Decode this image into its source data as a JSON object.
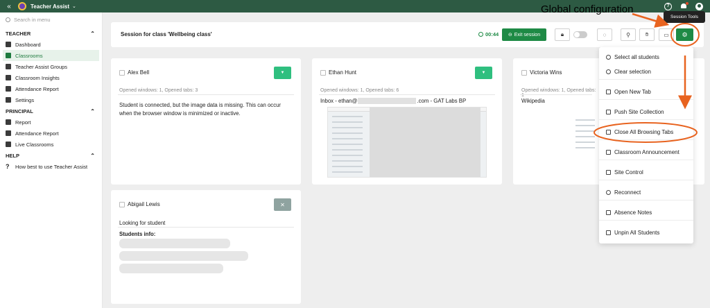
{
  "topbar": {
    "app_name": "Teacher Assist",
    "colors": {
      "bar": "#2d5a43",
      "accent": "#1e8a45",
      "annotation": "#e8631f"
    }
  },
  "sidebar": {
    "search_placeholder": "Search in menu",
    "sections": [
      {
        "title": "TEACHER",
        "items": [
          {
            "label": "Dashboard",
            "icon": "dashboard-icon"
          },
          {
            "label": "Classrooms",
            "icon": "classroom-icon",
            "active": true
          },
          {
            "label": "Teacher Assist Groups",
            "icon": "groups-icon"
          },
          {
            "label": "Classroom Insights",
            "icon": "insights-icon"
          },
          {
            "label": "Attendance Report",
            "icon": "attendance-icon"
          },
          {
            "label": "Settings",
            "icon": "gear-icon"
          }
        ]
      },
      {
        "title": "PRINCIPAL",
        "items": [
          {
            "label": "Report",
            "icon": "report-icon"
          },
          {
            "label": "Attendance Report",
            "icon": "attendance-icon"
          },
          {
            "label": "Live Classrooms",
            "icon": "live-icon"
          }
        ]
      },
      {
        "title": "HELP",
        "items": [
          {
            "label": "How best to use Teacher Assist",
            "icon": "question-icon"
          }
        ]
      }
    ]
  },
  "session": {
    "title": "Session for class 'Wellbeing class'",
    "timer": "00:44",
    "exit_label": "Exit session"
  },
  "cards": [
    {
      "name": "Alex Bell",
      "meta": "Opened windows: 1, Opened tabs: 3",
      "body": "Student is connected, but the image data is missing. This can occur when the browser window is minimized or inactive."
    },
    {
      "name": "Ethan Hunt",
      "meta": "Opened windows: 1, Opened tabs: 6",
      "tab_prefix": "Inbox - ethan@",
      "tab_suffix": ".com - GAT Labs BP"
    },
    {
      "name": "Victoria Wins",
      "meta": "Opened windows: 1, Opened tabs: 1",
      "tab_title": "Wikipedia"
    },
    {
      "name": "Abigail Lewis",
      "status": "Looking for student",
      "info_label": "Students info:"
    }
  ],
  "menu": {
    "items": [
      "Select all students",
      "Clear selection",
      "Open New Tab",
      "Push Site Collection",
      "Close All Browsing Tabs",
      "Classroom Announcement",
      "Site Control",
      "Reconnect",
      "Absence Notes",
      "Unpin All Students"
    ]
  },
  "annotations": {
    "global_label": "Global configuration",
    "tooltip": "Session Tools"
  }
}
